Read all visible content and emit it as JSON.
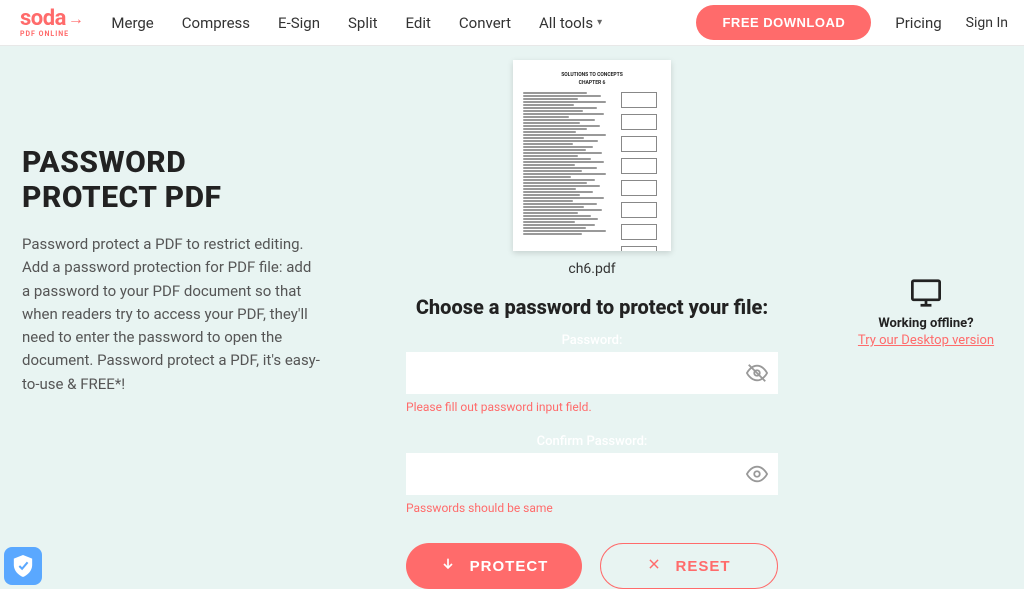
{
  "logo": {
    "top": "soda",
    "bottom": "PDF ONLINE"
  },
  "nav": {
    "merge": "Merge",
    "compress": "Compress",
    "esign": "E-Sign",
    "split": "Split",
    "edit": "Edit",
    "convert": "Convert",
    "alltools": "All tools"
  },
  "header": {
    "download": "FREE DOWNLOAD",
    "pricing": "Pricing",
    "signin": "Sign In"
  },
  "page": {
    "title_line1": "PASSWORD",
    "title_line2": "PROTECT PDF",
    "description": "Password protect a PDF to restrict editing. Add a password protection for PDF file: add a password to your PDF document so that when readers try to access your PDF, they'll need to enter the password to open the document. Password protect a PDF, it's easy-to-use & FREE*!"
  },
  "file": {
    "thumb_title1": "SOLUTIONS TO CONCEPTS",
    "thumb_title2": "CHAPTER 6",
    "name": "ch6.pdf"
  },
  "form": {
    "heading": "Choose a password to protect your file:",
    "password_label": "Password:",
    "password_value": "",
    "password_error": "Please fill out password input field.",
    "confirm_label": "Confirm Password:",
    "confirm_value": "",
    "confirm_error": "Passwords should be same",
    "protect_btn": "PROTECT",
    "reset_btn": "RESET"
  },
  "offline": {
    "heading": "Working offline?",
    "link": "Try our Desktop version"
  }
}
